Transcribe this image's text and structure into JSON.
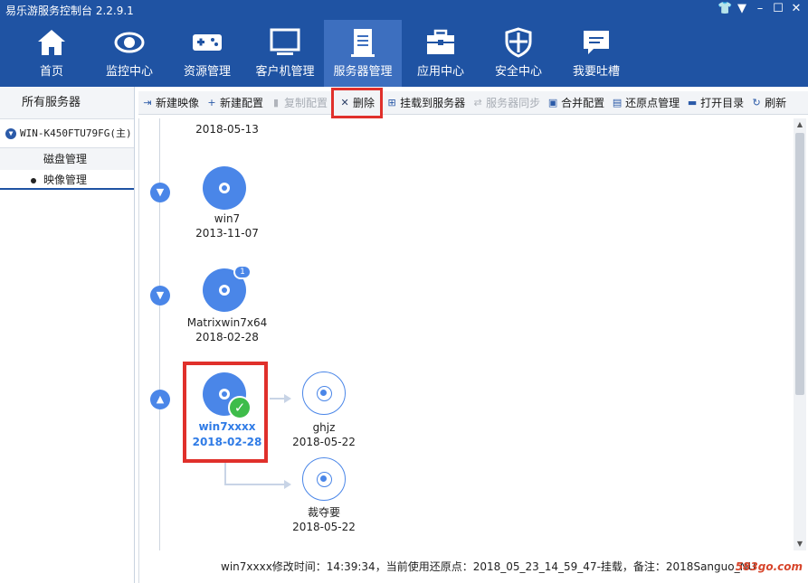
{
  "window": {
    "title": "易乐游服务控制台 2.2.9.1",
    "controls": [
      "shirt-icon",
      "dropdown-icon",
      "minimize-icon",
      "maximize-icon",
      "close-icon"
    ]
  },
  "nav": {
    "items": [
      {
        "label": "首页",
        "icon": "home-icon"
      },
      {
        "label": "监控中心",
        "icon": "eye-icon"
      },
      {
        "label": "资源管理",
        "icon": "gamepad-icon"
      },
      {
        "label": "客户机管理",
        "icon": "monitor-icon"
      },
      {
        "label": "服务器管理",
        "icon": "server-doc-icon",
        "active": true
      },
      {
        "label": "应用中心",
        "icon": "toolbox-icon"
      },
      {
        "label": "安全中心",
        "icon": "shield-icon"
      },
      {
        "label": "我要吐槽",
        "icon": "chat-icon"
      }
    ]
  },
  "sidebar": {
    "all_servers": "所有服务器",
    "server_name": "WIN-K450FTU79FG(主)",
    "disk_manage": "磁盘管理",
    "image_manage": "映像管理"
  },
  "toolbar": {
    "new_image": "新建映像",
    "new_config": "新建配置",
    "copy_config": "复制配置",
    "delete": "删除",
    "mount_server": "挂载到服务器",
    "server_sync": "服务器同步",
    "merge_config": "合并配置",
    "restore_manage": "还原点管理",
    "open_dir": "打开目录",
    "refresh": "刷新"
  },
  "images": {
    "top_date": "2018-05-13",
    "win7": {
      "name": "win7",
      "date": "2013-11-07"
    },
    "matrix": {
      "name": "Matrixwin7x64",
      "date": "2018-02-28",
      "badge": "1"
    },
    "win7xxxx": {
      "name": "win7xxxx",
      "date": "2018-02-28"
    },
    "ghjz": {
      "name": "ghjz",
      "date": "2018-05-22"
    },
    "caiduoyao": {
      "name": "裁夺要",
      "date": "2018-05-22"
    }
  },
  "status": {
    "text": "win7xxxx修改时间：14:39:34，当前使用还原点：2018_05_23_14_59_47-挂载，备注：2018Sanguo_NU"
  },
  "watermark": "583go.com",
  "colors": {
    "header_bg": "#1f53a3",
    "nav_active": "#3d6fbf",
    "accent": "#4a86e8",
    "highlight_red": "#e0302b",
    "check_green": "#3ebc4a"
  }
}
